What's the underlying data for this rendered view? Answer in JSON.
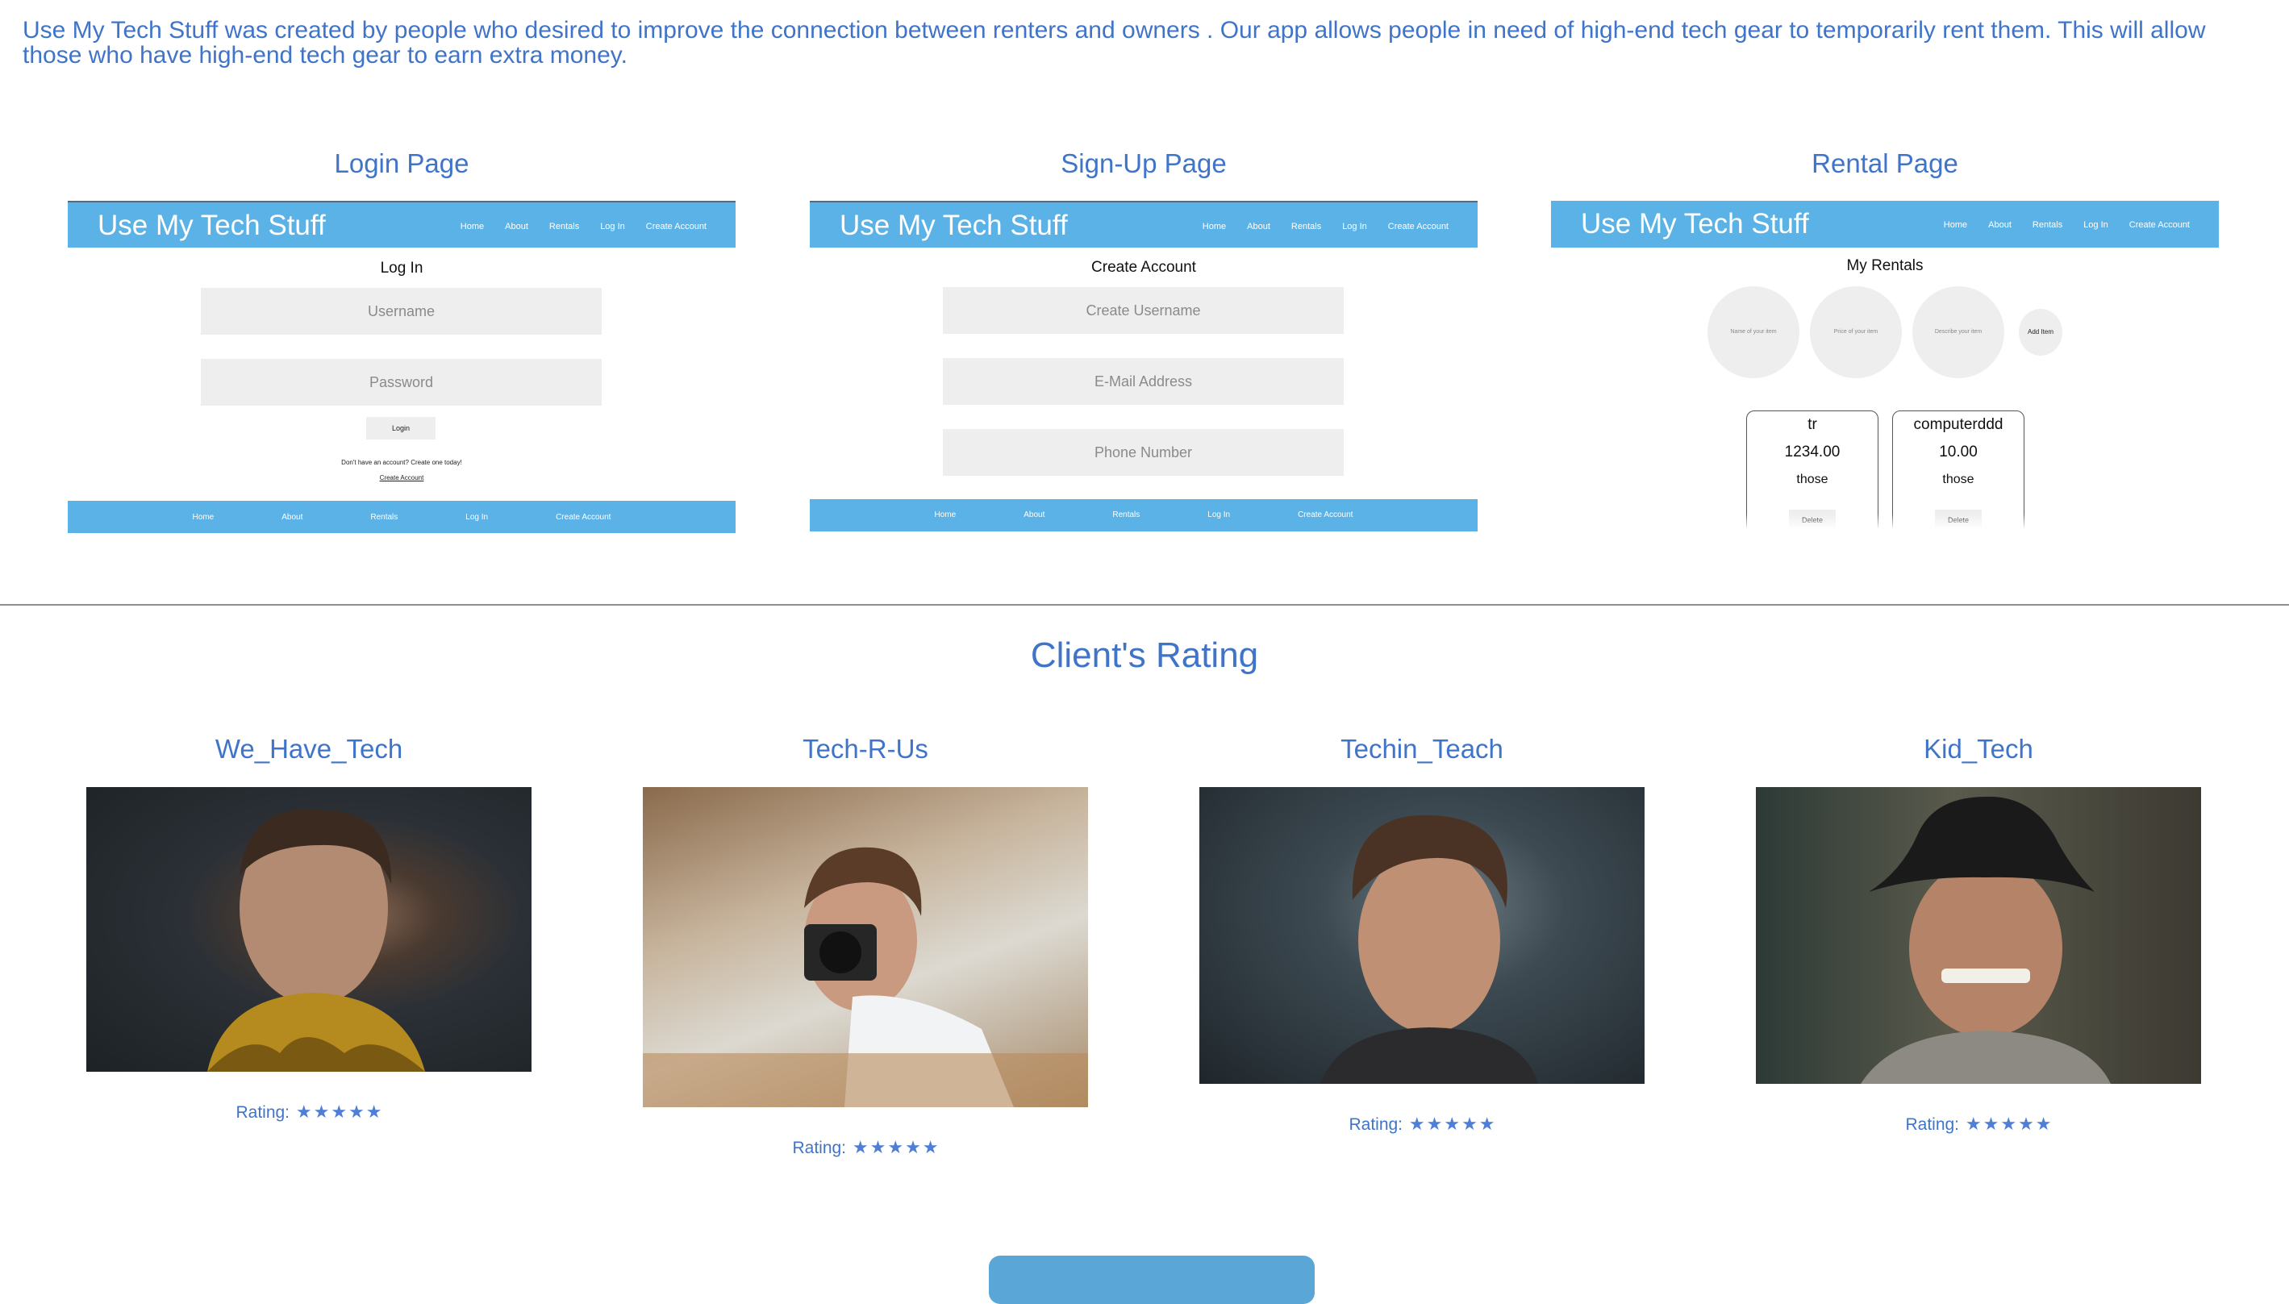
{
  "intro": "Use My Tech Stuff was created by people who desired to improve the connection between renters and owners . Our app allows people in need of high-end tech gear to temporarily rent them. This will allow those who have high-end tech gear to earn extra money.",
  "screenshots": {
    "login": {
      "title": "Login Page",
      "brand": "Use My Tech Stuff",
      "nav": [
        "Home",
        "About",
        "Rentals",
        "Log In",
        "Create Account"
      ],
      "heading": "Log In",
      "username_placeholder": "Username",
      "password_placeholder": "Password",
      "login_button": "Login",
      "prompt": "Don't have an account? Create one today!",
      "create_link": "Create Account",
      "footer_nav": [
        "Home",
        "About",
        "Rentals",
        "Log In",
        "Create Account"
      ]
    },
    "signup": {
      "title": "Sign-Up Page",
      "brand": "Use My Tech Stuff",
      "nav": [
        "Home",
        "About",
        "Rentals",
        "Log In",
        "Create Account"
      ],
      "heading": "Create Account",
      "username_placeholder": "Create Username",
      "email_placeholder": "E-Mail Address",
      "phone_placeholder": "Phone Number",
      "footer_nav": [
        "Home",
        "About",
        "Rentals",
        "Log In",
        "Create Account"
      ]
    },
    "rental": {
      "title": "Rental Page",
      "brand": "Use My Tech Stuff",
      "nav": [
        "Home",
        "About",
        "Rentals",
        "Log In",
        "Create Account"
      ],
      "heading": "My Rentals",
      "inputs": [
        "Name of your item",
        "Price of your item",
        "Describe your item"
      ],
      "add_button": "Add Item",
      "items": [
        {
          "name": "tr",
          "price": "1234.00",
          "description": "those",
          "delete": "Delete"
        },
        {
          "name": "computerddd",
          "price": "10.00",
          "description": "those",
          "delete": "Delete"
        }
      ]
    }
  },
  "ratings_section": {
    "heading": "Client's Rating",
    "rating_label": "Rating:",
    "star_glyph": "★",
    "max_stars": 5,
    "clients": [
      {
        "name": "We_Have_Tech",
        "stars": 5
      },
      {
        "name": "Tech-R-Us",
        "stars": 5
      },
      {
        "name": "Techin_Teach",
        "stars": 5
      },
      {
        "name": "Kid_Tech",
        "stars": 5
      }
    ]
  },
  "colors": {
    "accent_text": "#3f74c9",
    "nav_blue": "#5bb2e6",
    "star": "#4e7ed6",
    "button_blue": "#5aa6d6"
  }
}
